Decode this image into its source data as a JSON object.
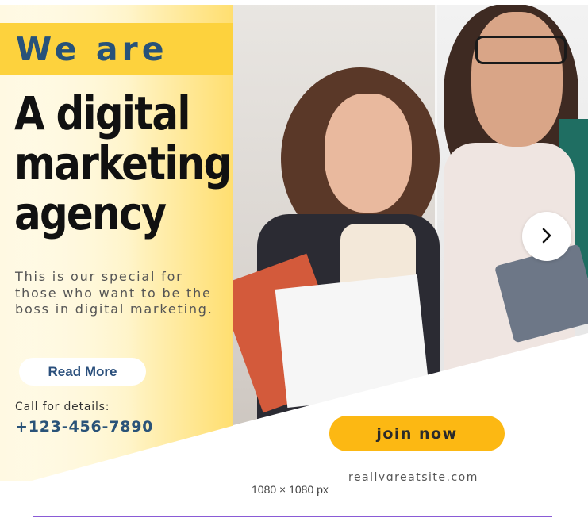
{
  "banner": {
    "we_are": "We are",
    "headline": "A digital marketing agency",
    "tagline": "This is our special for those who want to be the boss in digital marketing.",
    "read_more": "Read More",
    "call_label": "Call for details:",
    "phone": "+123-456-7890",
    "join_now": "join now",
    "website": "reallygreatsite.com"
  },
  "dimension_label": "1080 × 1080 px",
  "colors": {
    "accent_yellow": "#fdd23d",
    "button_yellow": "#fcb813",
    "brand_blue": "#27527a",
    "selection_purple": "#8a5bd6"
  },
  "icons": {
    "next": "chevron-right-icon"
  }
}
